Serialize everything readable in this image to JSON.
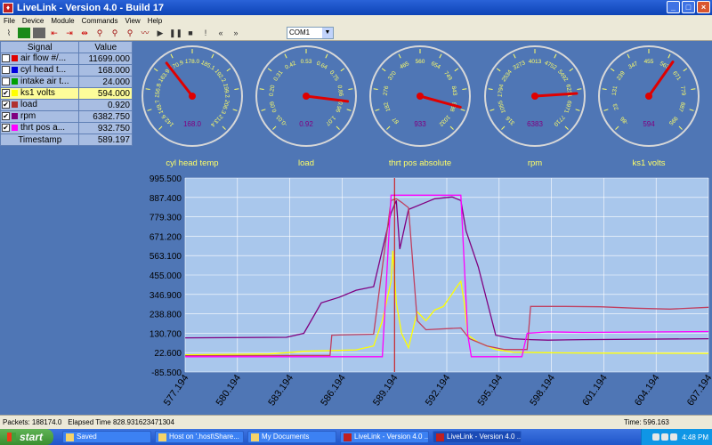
{
  "window": {
    "title": "LiveLink - Version 4.0 - Build 17",
    "min": "_",
    "max": "□",
    "close": "×"
  },
  "menu": [
    "File",
    "Device",
    "Module",
    "Commands",
    "View",
    "Help"
  ],
  "toolbar": {
    "com_port": "COM1"
  },
  "signals": {
    "header_signal": "Signal",
    "header_value": "Value",
    "rows": [
      {
        "name": "air flow #/...",
        "value": "11699.000",
        "checked": false,
        "color": "#e00000",
        "selected": false
      },
      {
        "name": "cyl head t...",
        "value": "168.000",
        "checked": false,
        "color": "#0000e0",
        "selected": false
      },
      {
        "name": "intake air t...",
        "value": "24.000",
        "checked": false,
        "color": "#00a000",
        "selected": false
      },
      {
        "name": "ks1 volts",
        "value": "594.000",
        "checked": true,
        "color": "#ffff00",
        "selected": true
      },
      {
        "name": "load",
        "value": "0.920",
        "checked": true,
        "color": "#b03030",
        "selected": false
      },
      {
        "name": "rpm",
        "value": "6382.750",
        "checked": true,
        "color": "#800080",
        "selected": false
      },
      {
        "name": "thrt pos a...",
        "value": "932.750",
        "checked": true,
        "color": "#ff00ff",
        "selected": false
      }
    ],
    "timestamp_label": "Timestamp",
    "timestamp_value": "589.197"
  },
  "gauges": [
    {
      "name": "cyl head temp",
      "value_text": "168.0",
      "ticks": [
        "142.6",
        "149.7",
        "156.8",
        "163.9",
        "170.9",
        "178.0",
        "185.1",
        "192.2",
        "199.2",
        "206.3",
        "213.4"
      ],
      "needle_fraction": 0.36
    },
    {
      "name": "load",
      "value_text": "0.92",
      "ticks": [
        "-0.01",
        "0.09",
        "0.20",
        "0.31",
        "0.42",
        "0.53",
        "0.64",
        "0.75",
        "0.86",
        "0.96",
        "1.07"
      ],
      "needle_fraction": 0.86
    },
    {
      "name": "thrt pos absolute",
      "value_text": "933",
      "ticks": [
        "87",
        "182",
        "276",
        "370",
        "465",
        "560",
        "654",
        "749",
        "843",
        "938",
        "1032"
      ],
      "needle_fraction": 0.89
    },
    {
      "name": "rpm",
      "value_text": "6383",
      "ticks": [
        "316",
        "1055",
        "1794",
        "2534",
        "3273",
        "4013",
        "4752",
        "5492",
        "6231",
        "6971",
        "7710"
      ],
      "needle_fraction": 0.82
    },
    {
      "name": "ks1 volts",
      "value_text": "594",
      "ticks": [
        "-86",
        "23",
        "131",
        "239",
        "347",
        "455",
        "563",
        "671",
        "779",
        "887",
        "995"
      ],
      "needle_fraction": 0.63
    }
  ],
  "chart_data": {
    "type": "line",
    "y_ticks": [
      "995.500",
      "887.400",
      "779.300",
      "671.200",
      "563.100",
      "455.000",
      "346.900",
      "238.800",
      "130.700",
      "22.600",
      "-85.500"
    ],
    "x_ticks": [
      "577.194",
      "580.194",
      "583.194",
      "586.194",
      "589.194",
      "592.194",
      "595.194",
      "598.194",
      "601.194",
      "604.194",
      "607.194"
    ],
    "xlim": [
      577.194,
      607.194
    ],
    "ylim": [
      -85.5,
      995.5
    ],
    "cursor_x": 589.197,
    "series": [
      {
        "color": "#ffff00",
        "points": [
          [
            577.2,
            10
          ],
          [
            582.0,
            15
          ],
          [
            583.0,
            22
          ],
          [
            584.0,
            30
          ],
          [
            586.0,
            35
          ],
          [
            587.0,
            38
          ],
          [
            588.0,
            60
          ],
          [
            588.5,
            200
          ],
          [
            589.0,
            420
          ],
          [
            589.1,
            590
          ],
          [
            589.3,
            300
          ],
          [
            589.6,
            130
          ],
          [
            590.0,
            50
          ],
          [
            590.5,
            250
          ],
          [
            591.0,
            200
          ],
          [
            591.5,
            260
          ],
          [
            592.0,
            280
          ],
          [
            592.5,
            350
          ],
          [
            592.7,
            380
          ],
          [
            593.0,
            420
          ],
          [
            593.2,
            300
          ],
          [
            593.4,
            120
          ],
          [
            594.0,
            80
          ],
          [
            595.0,
            40
          ],
          [
            596.0,
            25
          ],
          [
            598.0,
            22
          ],
          [
            600.0,
            20
          ],
          [
            607.2,
            18
          ]
        ]
      },
      {
        "color": "#800080",
        "points": [
          [
            577.2,
            105
          ],
          [
            583.0,
            108
          ],
          [
            584.0,
            130
          ],
          [
            585.0,
            300
          ],
          [
            586.0,
            330
          ],
          [
            587.0,
            370
          ],
          [
            588.0,
            390
          ],
          [
            589.0,
            800
          ],
          [
            589.3,
            870
          ],
          [
            589.5,
            600
          ],
          [
            590.0,
            820
          ],
          [
            591.0,
            860
          ],
          [
            591.5,
            880
          ],
          [
            592.5,
            890
          ],
          [
            593.0,
            870
          ],
          [
            593.3,
            700
          ],
          [
            594.0,
            500
          ],
          [
            595.0,
            120
          ],
          [
            596.0,
            100
          ],
          [
            597.0,
            95
          ],
          [
            598.0,
            92
          ],
          [
            600.0,
            95
          ],
          [
            607.2,
            100
          ]
        ]
      },
      {
        "color": "#c04060",
        "points": [
          [
            577.2,
            5
          ],
          [
            585.5,
            7
          ],
          [
            585.6,
            120
          ],
          [
            588.0,
            125
          ],
          [
            589.0,
            870
          ],
          [
            589.3,
            880
          ],
          [
            589.6,
            860
          ],
          [
            590.0,
            830
          ],
          [
            590.5,
            200
          ],
          [
            591.0,
            150
          ],
          [
            593.0,
            160
          ],
          [
            593.5,
            100
          ],
          [
            594.5,
            60
          ],
          [
            595.5,
            40
          ],
          [
            596.8,
            40
          ],
          [
            597.0,
            280
          ],
          [
            599.0,
            280
          ],
          [
            601.0,
            278
          ],
          [
            603.0,
            270
          ],
          [
            605.0,
            265
          ],
          [
            607.2,
            275
          ]
        ]
      },
      {
        "color": "#ff00ff",
        "points": [
          [
            577.2,
            0
          ],
          [
            588.5,
            0
          ],
          [
            589.0,
            900
          ],
          [
            593.0,
            900
          ],
          [
            593.4,
            120
          ],
          [
            593.6,
            0
          ],
          [
            596.5,
            0
          ],
          [
            596.8,
            130
          ],
          [
            598.0,
            138
          ],
          [
            600.0,
            135
          ],
          [
            607.2,
            140
          ]
        ]
      }
    ]
  },
  "status": {
    "packets": "Packets: 188174.0",
    "elapsed": "Elapsed Time 828.931623471304",
    "time": "Time: 596.163"
  },
  "taskbar": {
    "start": "start",
    "items": [
      {
        "label": "Saved",
        "active": false,
        "red": false
      },
      {
        "label": "Host on '.host\\Share...",
        "active": false,
        "red": false
      },
      {
        "label": "My Documents",
        "active": false,
        "red": false
      },
      {
        "label": "LiveLink - Version 4.0 ...",
        "active": false,
        "red": true
      },
      {
        "label": "LiveLink - Version 4.0 ...",
        "active": true,
        "red": true
      }
    ],
    "clock": "4:48 PM"
  },
  "colors": {
    "background": "#4f76b5",
    "plot_bg": "#a9c7ec",
    "gauge_face": "#4f76b5",
    "needle": "#e00000"
  }
}
